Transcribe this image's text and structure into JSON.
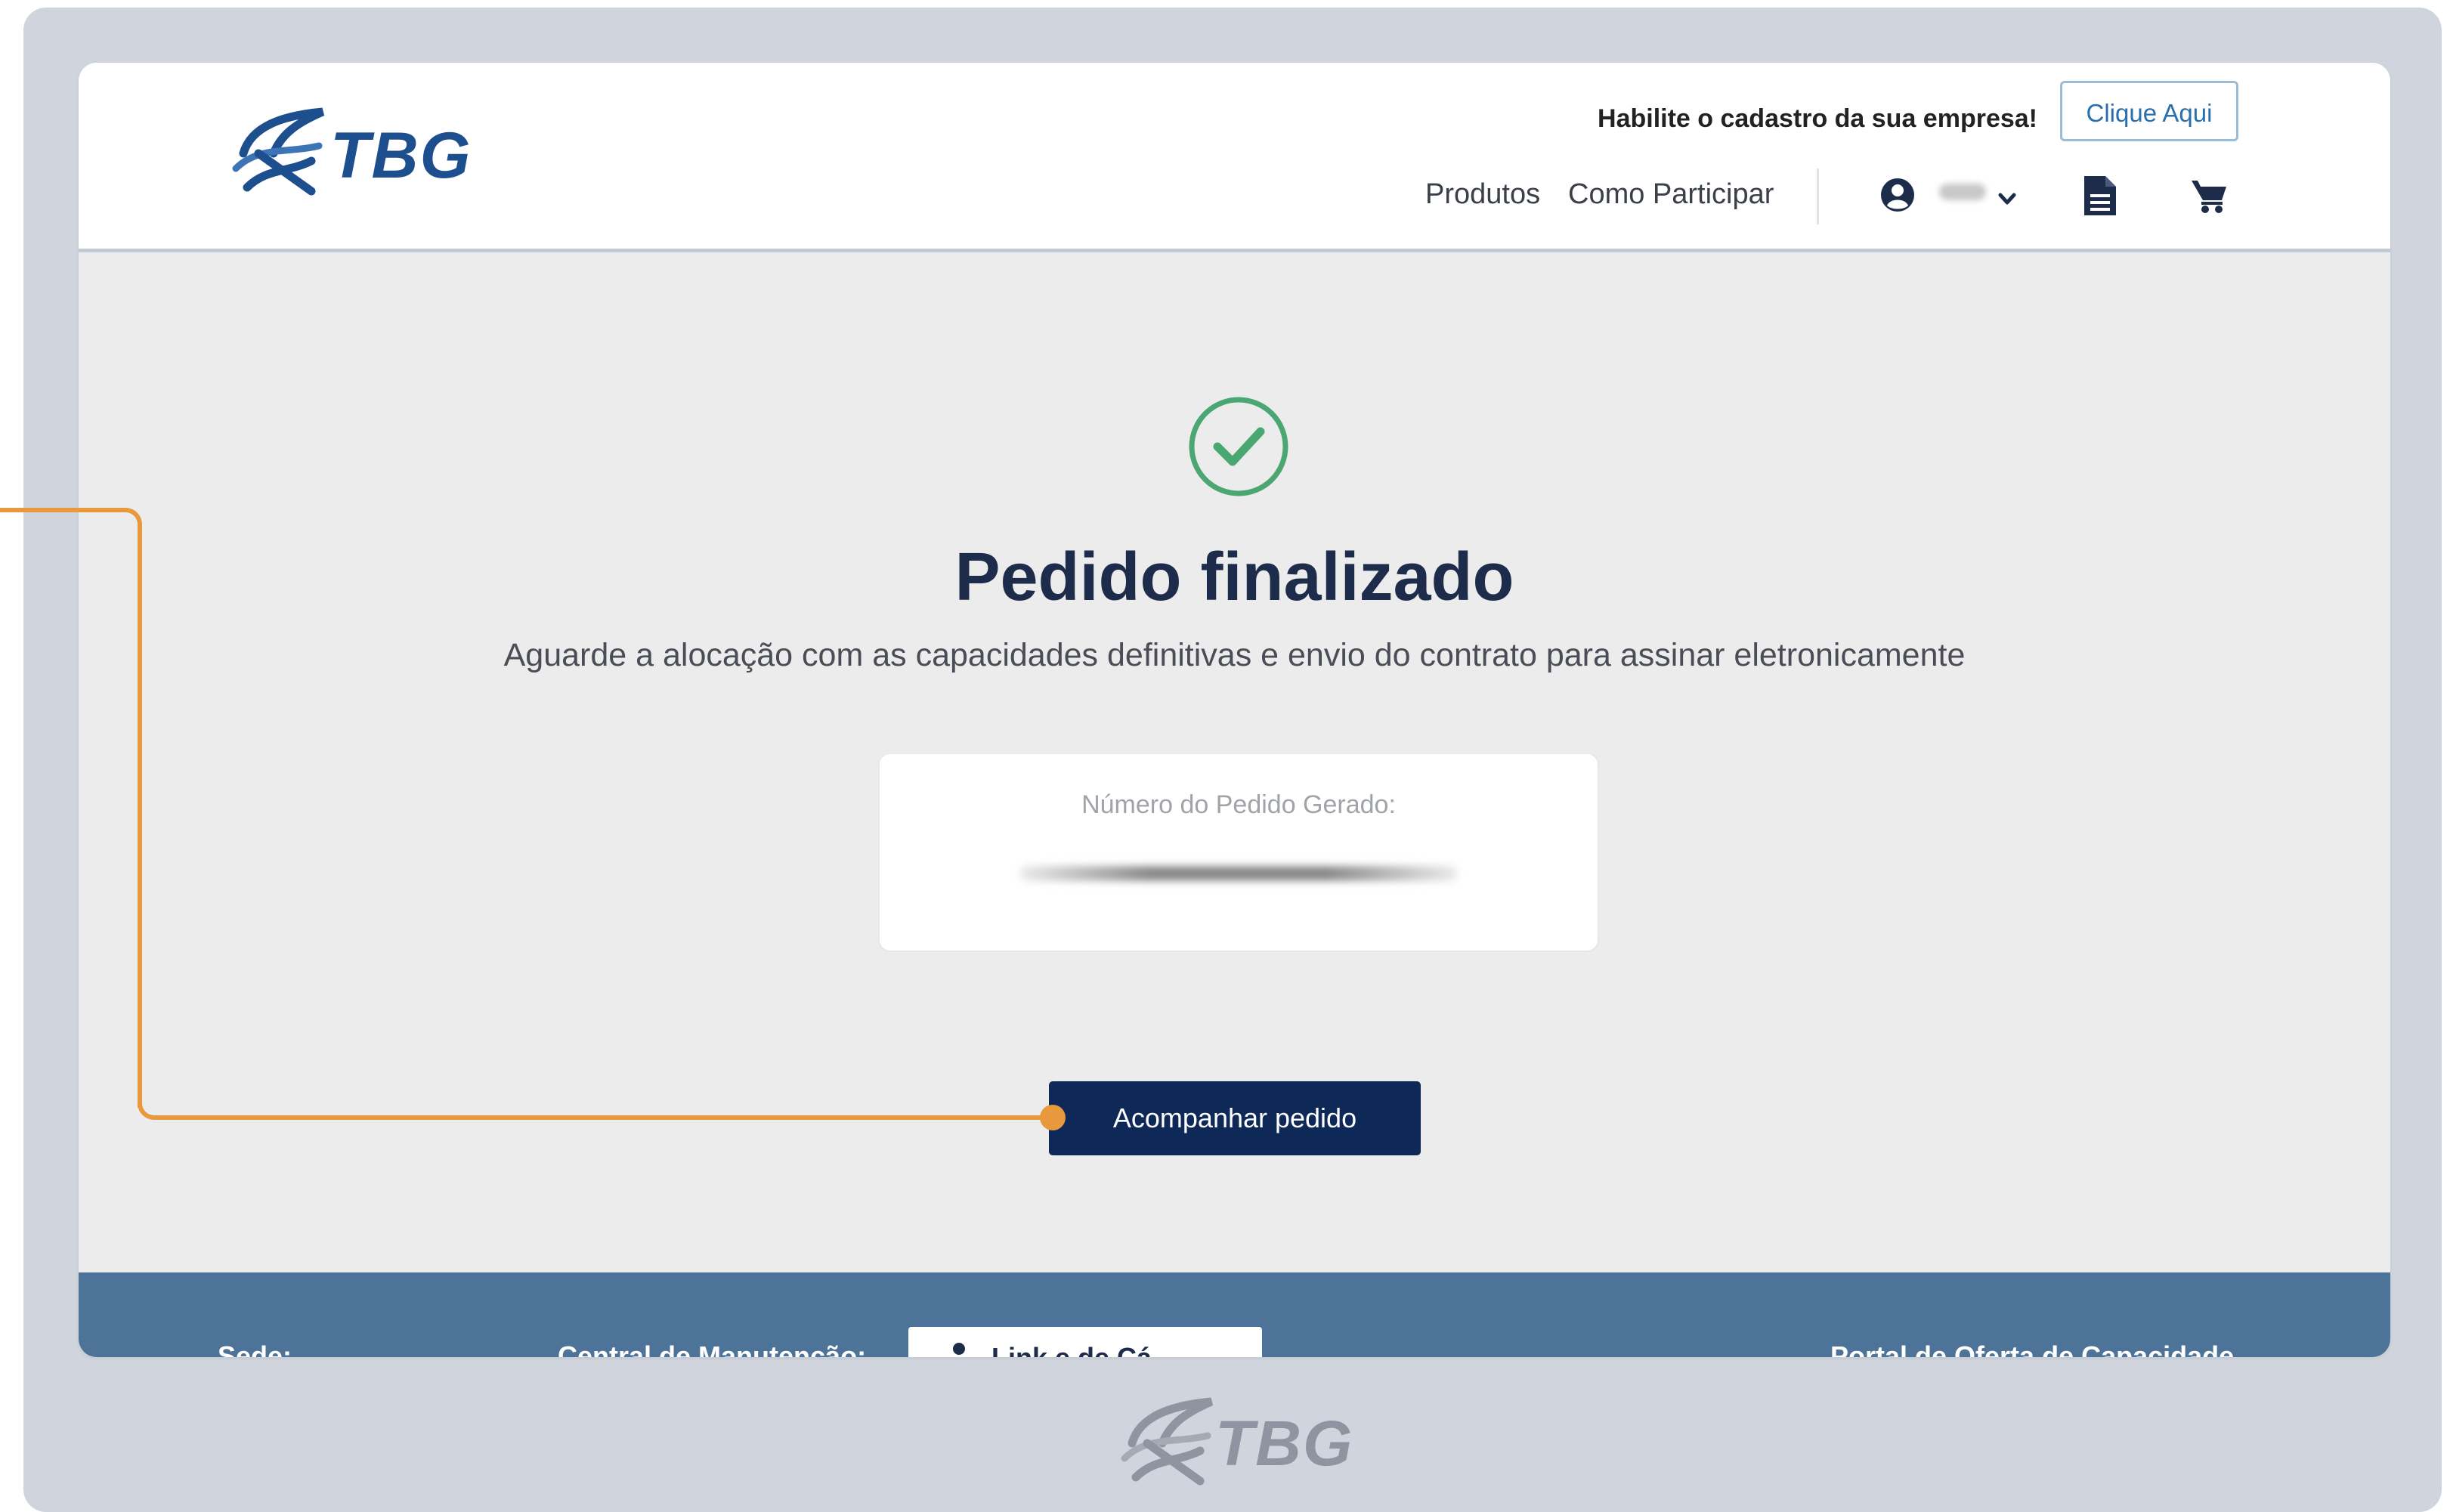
{
  "header": {
    "brand": "TBG",
    "cta_text": "Habilite o cadastro da sua empresa!",
    "cta_button": "Clique Aqui",
    "nav": [
      "Produtos",
      "Como Participar"
    ],
    "icons": [
      "user-icon",
      "chevron-down-icon",
      "document-icon",
      "cart-icon"
    ]
  },
  "main": {
    "status_icon": "check-circle-icon",
    "title": "Pedido finalizado",
    "subtitle": "Aguarde a alocação com as capacidades definitivas e envio do contrato para assinar eletronicamente",
    "order_label": "Número do Pedido Gerado:",
    "track_button": "Acompanhar pedido"
  },
  "footer": {
    "col1": "Sede:",
    "col2": "Central de Manutenção:",
    "col3": "Link e de Cá",
    "col4": "Portal de Oferta de Capacidade"
  },
  "watermark": {
    "brand": "TBG"
  },
  "colors": {
    "primary": "#0e2857",
    "accent_link": "#2a6fab",
    "success": "#4aa772",
    "footer_bg": "#4e7399",
    "callout": "#e8993d"
  }
}
